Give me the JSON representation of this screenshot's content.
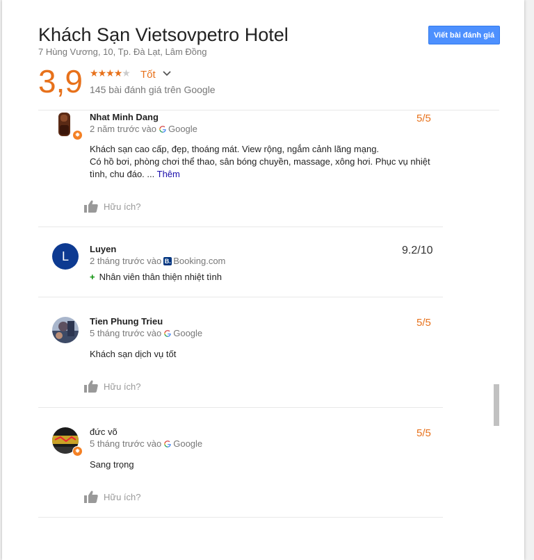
{
  "hotel": {
    "name": "Khách Sạn Vietsovpetro Hotel",
    "address": "7 Hùng Vương, 10, Tp. Đà Lạt, Lâm Đồng",
    "write_review_label": "Viết bài đánh giá",
    "score": "3,9",
    "stars_filled": 4,
    "stars_total": 5,
    "rating_word": "Tốt",
    "review_count": "145 bài đánh giá trên Google"
  },
  "colors": {
    "accent_orange": "#e7711b",
    "button_blue": "#4d90fe",
    "link_blue": "#1a0dab",
    "booking_navy": "#003580"
  },
  "reviews": [
    {
      "author": "Nhat Minh Dang",
      "time": "2 năm trước vào",
      "source": "Google",
      "score": "5/5",
      "text_line1": "Khách sạn cao cấp, đẹp, thoáng mát. View rộng, ngắm cảnh lãng mạng.",
      "text_line2": "Có hồ bơi, phòng chơi thể thao, sân bóng chuyền, massage, xông hơi. Phục vụ nhiệt",
      "text_line3": "tình, chu đáo. ...",
      "more_label": "Thêm",
      "helpful_label": "Hữu ích?"
    },
    {
      "author": "Luyen",
      "avatar_letter": "L",
      "time": "2 tháng trước vào",
      "source": "Booking.com",
      "source_icon_letter": "B.",
      "score": "9.2/10",
      "positive": "Nhân viên thân thiện nhiệt tình"
    },
    {
      "author": "Tien Phung Trieu",
      "time": "5 tháng trước vào",
      "source": "Google",
      "score": "5/5",
      "text": "Khách sạn dịch vụ tốt",
      "helpful_label": "Hữu ích?"
    },
    {
      "author": "đức võ",
      "time": "5 tháng trước vào",
      "source": "Google",
      "score": "5/5",
      "text": "Sang trọng",
      "helpful_label": "Hữu ích?"
    }
  ]
}
